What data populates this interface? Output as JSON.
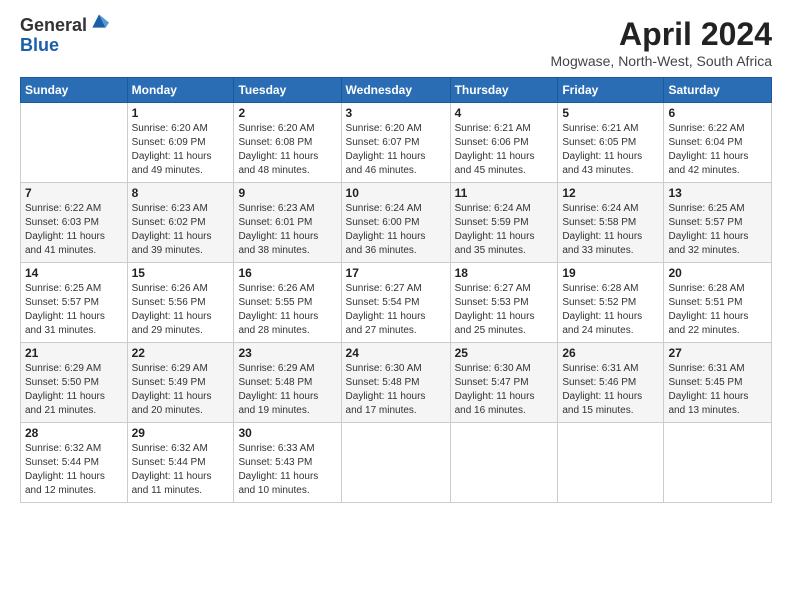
{
  "logo": {
    "general": "General",
    "blue": "Blue"
  },
  "header": {
    "month": "April 2024",
    "location": "Mogwase, North-West, South Africa"
  },
  "weekdays": [
    "Sunday",
    "Monday",
    "Tuesday",
    "Wednesday",
    "Thursday",
    "Friday",
    "Saturday"
  ],
  "weeks": [
    [
      {
        "day": "",
        "info": ""
      },
      {
        "day": "1",
        "info": "Sunrise: 6:20 AM\nSunset: 6:09 PM\nDaylight: 11 hours\nand 49 minutes."
      },
      {
        "day": "2",
        "info": "Sunrise: 6:20 AM\nSunset: 6:08 PM\nDaylight: 11 hours\nand 48 minutes."
      },
      {
        "day": "3",
        "info": "Sunrise: 6:20 AM\nSunset: 6:07 PM\nDaylight: 11 hours\nand 46 minutes."
      },
      {
        "day": "4",
        "info": "Sunrise: 6:21 AM\nSunset: 6:06 PM\nDaylight: 11 hours\nand 45 minutes."
      },
      {
        "day": "5",
        "info": "Sunrise: 6:21 AM\nSunset: 6:05 PM\nDaylight: 11 hours\nand 43 minutes."
      },
      {
        "day": "6",
        "info": "Sunrise: 6:22 AM\nSunset: 6:04 PM\nDaylight: 11 hours\nand 42 minutes."
      }
    ],
    [
      {
        "day": "7",
        "info": "Sunrise: 6:22 AM\nSunset: 6:03 PM\nDaylight: 11 hours\nand 41 minutes."
      },
      {
        "day": "8",
        "info": "Sunrise: 6:23 AM\nSunset: 6:02 PM\nDaylight: 11 hours\nand 39 minutes."
      },
      {
        "day": "9",
        "info": "Sunrise: 6:23 AM\nSunset: 6:01 PM\nDaylight: 11 hours\nand 38 minutes."
      },
      {
        "day": "10",
        "info": "Sunrise: 6:24 AM\nSunset: 6:00 PM\nDaylight: 11 hours\nand 36 minutes."
      },
      {
        "day": "11",
        "info": "Sunrise: 6:24 AM\nSunset: 5:59 PM\nDaylight: 11 hours\nand 35 minutes."
      },
      {
        "day": "12",
        "info": "Sunrise: 6:24 AM\nSunset: 5:58 PM\nDaylight: 11 hours\nand 33 minutes."
      },
      {
        "day": "13",
        "info": "Sunrise: 6:25 AM\nSunset: 5:57 PM\nDaylight: 11 hours\nand 32 minutes."
      }
    ],
    [
      {
        "day": "14",
        "info": "Sunrise: 6:25 AM\nSunset: 5:57 PM\nDaylight: 11 hours\nand 31 minutes."
      },
      {
        "day": "15",
        "info": "Sunrise: 6:26 AM\nSunset: 5:56 PM\nDaylight: 11 hours\nand 29 minutes."
      },
      {
        "day": "16",
        "info": "Sunrise: 6:26 AM\nSunset: 5:55 PM\nDaylight: 11 hours\nand 28 minutes."
      },
      {
        "day": "17",
        "info": "Sunrise: 6:27 AM\nSunset: 5:54 PM\nDaylight: 11 hours\nand 27 minutes."
      },
      {
        "day": "18",
        "info": "Sunrise: 6:27 AM\nSunset: 5:53 PM\nDaylight: 11 hours\nand 25 minutes."
      },
      {
        "day": "19",
        "info": "Sunrise: 6:28 AM\nSunset: 5:52 PM\nDaylight: 11 hours\nand 24 minutes."
      },
      {
        "day": "20",
        "info": "Sunrise: 6:28 AM\nSunset: 5:51 PM\nDaylight: 11 hours\nand 22 minutes."
      }
    ],
    [
      {
        "day": "21",
        "info": "Sunrise: 6:29 AM\nSunset: 5:50 PM\nDaylight: 11 hours\nand 21 minutes."
      },
      {
        "day": "22",
        "info": "Sunrise: 6:29 AM\nSunset: 5:49 PM\nDaylight: 11 hours\nand 20 minutes."
      },
      {
        "day": "23",
        "info": "Sunrise: 6:29 AM\nSunset: 5:48 PM\nDaylight: 11 hours\nand 19 minutes."
      },
      {
        "day": "24",
        "info": "Sunrise: 6:30 AM\nSunset: 5:48 PM\nDaylight: 11 hours\nand 17 minutes."
      },
      {
        "day": "25",
        "info": "Sunrise: 6:30 AM\nSunset: 5:47 PM\nDaylight: 11 hours\nand 16 minutes."
      },
      {
        "day": "26",
        "info": "Sunrise: 6:31 AM\nSunset: 5:46 PM\nDaylight: 11 hours\nand 15 minutes."
      },
      {
        "day": "27",
        "info": "Sunrise: 6:31 AM\nSunset: 5:45 PM\nDaylight: 11 hours\nand 13 minutes."
      }
    ],
    [
      {
        "day": "28",
        "info": "Sunrise: 6:32 AM\nSunset: 5:44 PM\nDaylight: 11 hours\nand 12 minutes."
      },
      {
        "day": "29",
        "info": "Sunrise: 6:32 AM\nSunset: 5:44 PM\nDaylight: 11 hours\nand 11 minutes."
      },
      {
        "day": "30",
        "info": "Sunrise: 6:33 AM\nSunset: 5:43 PM\nDaylight: 11 hours\nand 10 minutes."
      },
      {
        "day": "",
        "info": ""
      },
      {
        "day": "",
        "info": ""
      },
      {
        "day": "",
        "info": ""
      },
      {
        "day": "",
        "info": ""
      }
    ]
  ]
}
